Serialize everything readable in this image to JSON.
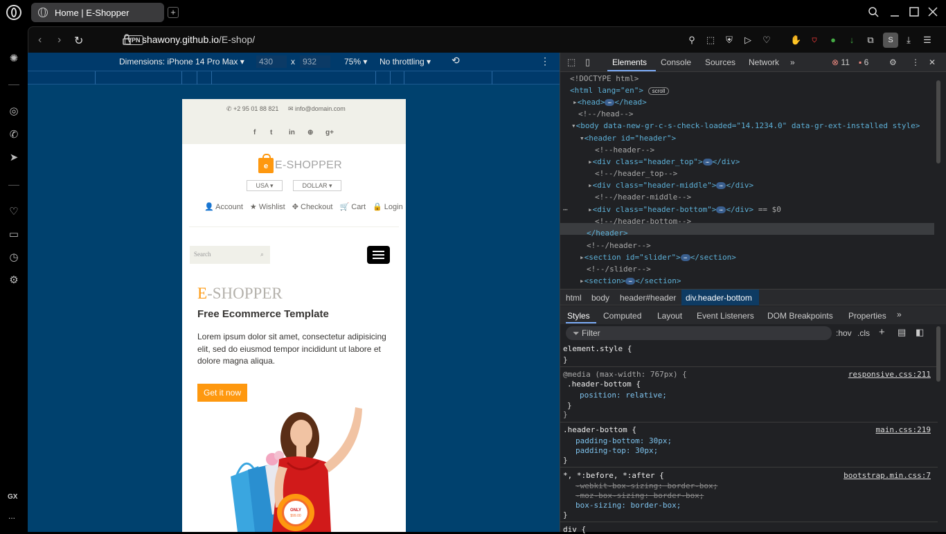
{
  "browser": {
    "tab_title": "Home | E-Shopper",
    "new_tab": "+",
    "vpn_label": "VPN",
    "url_host": "shawony.github.io",
    "url_path": "/E-shop/",
    "sidebar_bottom_label": "GX",
    "sidebar_more": "..."
  },
  "device_toolbar": {
    "dimensions_label": "Dimensions: iPhone 14 Pro Max",
    "width": "430",
    "times": "x",
    "height": "932",
    "zoom": "75%",
    "throttling": "No throttling"
  },
  "site": {
    "phone": "+2 95 01 88 821",
    "email": "info@domain.com",
    "social": [
      "f",
      "t",
      "in",
      "⊕",
      "g+"
    ],
    "logo_e": "e",
    "logo_text": "E-SHOPPER",
    "currency_country": "USA",
    "currency_unit": "DOLLAR",
    "account_links": [
      "Account",
      "Wishlist",
      "Checkout",
      "Cart",
      "Login"
    ],
    "search_placeholder": "Search",
    "hero_title_first": "E",
    "hero_title_rest": "-SHOPPER",
    "hero_subtitle": "Free Ecommerce Template",
    "hero_text": "Lorem ipsum dolor sit amet, consectetur adipisicing elit, sed do eiusmod tempor incididunt ut labore et dolore magna aliqua.",
    "hero_button": "Get it now",
    "price_tag_top": "ONLY",
    "price_tag_price": "$99.00"
  },
  "devtools": {
    "tabs": [
      "Elements",
      "Console",
      "Sources",
      "Network"
    ],
    "error_count": "11",
    "warning_count": "6",
    "dom": {
      "doctype": "<!DOCTYPE html>",
      "html_open": "<html lang=\"en\">",
      "scroll_badge": "scroll",
      "head": "<head>",
      "head_close": "</head>",
      "head_comment": "<!--/head-->",
      "body_open": "<body data-new-gr-c-s-check-loaded=\"14.1234.0\" data-gr-ext-installed style>",
      "header_open": "<header id=\"header\">",
      "header_comment": "<!--header-->",
      "div_top": "<div class=\"header_top\">",
      "div_close": "</div>",
      "top_comment": "<!--/header_top-->",
      "div_middle": "<div class=\"header-middle\">",
      "middle_comment": "<!--/header-middle-->",
      "div_bottom": "<div class=\"header-bottom\">",
      "selected_marker": "== $0",
      "bottom_comment": "<!--/header-bottom-->",
      "header_close": "</header>",
      "header_end_comment": "<!--/header-->",
      "section_slider": "<section id=\"slider\">",
      "section_close": "</section>",
      "slider_comment": "<!--/slider-->",
      "section": "<section>"
    },
    "breadcrumbs": [
      "html",
      "body",
      "header#header",
      "div.header-bottom"
    ],
    "style_tabs": [
      "Styles",
      "Computed",
      "Layout",
      "Event Listeners",
      "DOM Breakpoints",
      "Properties"
    ],
    "filter_placeholder": "Filter",
    "hov": ":hov",
    "cls": ".cls",
    "rules": {
      "element_style": "element.style {",
      "close": "}",
      "media": "@media (max-width: 767px) {",
      "sel1": ".header-bottom {",
      "prop1": "position: relative;",
      "src1": "responsive.css:211",
      "sel2": ".header-bottom {",
      "prop2a": "padding-bottom: 30px;",
      "prop2b": "padding-top: 30px;",
      "src2": "main.css:219",
      "sel3": "*, *:before, *:after {",
      "prop3a": "-webkit-box-sizing: border-box;",
      "prop3b": "-moz-box-sizing: border-box;",
      "prop3c": "box-sizing: border-box;",
      "src3": "bootstrap.min.css:7",
      "sel4": "div {"
    }
  }
}
